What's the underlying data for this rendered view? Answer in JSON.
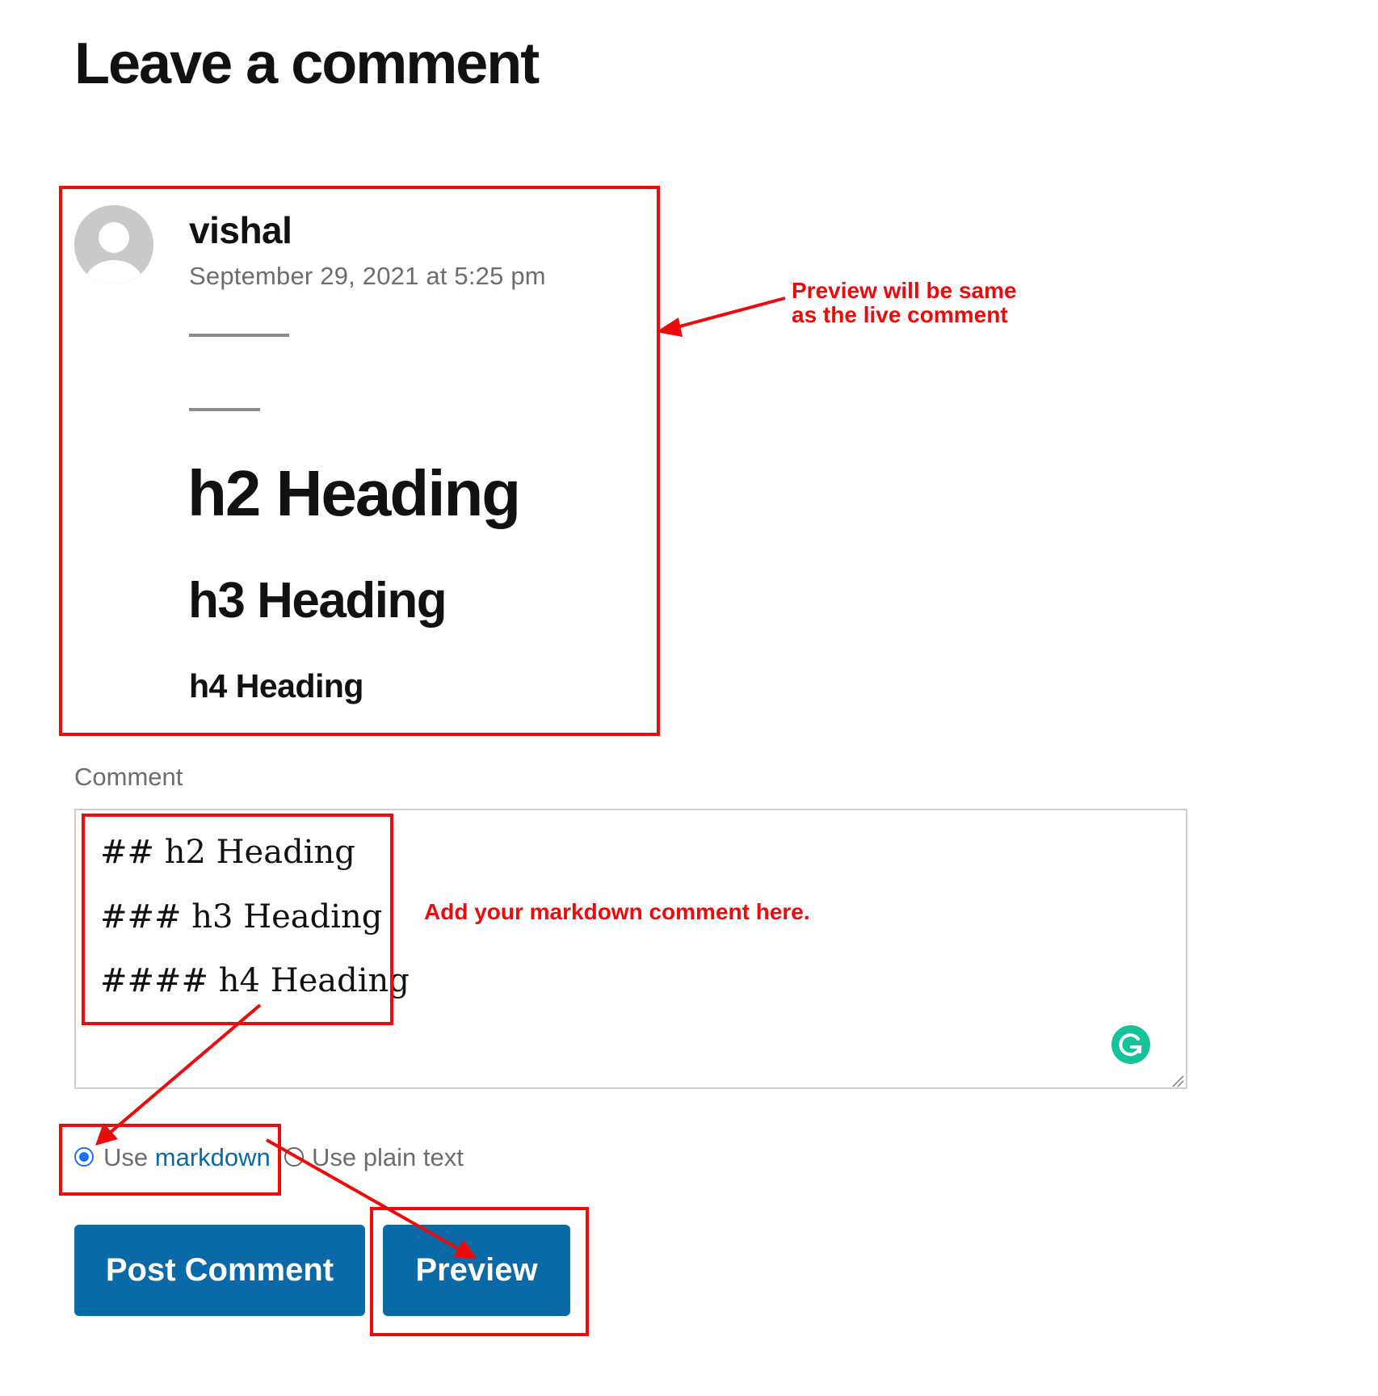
{
  "page": {
    "title": "Leave a comment"
  },
  "preview": {
    "author": "vishal",
    "date": "September 29, 2021 at 5:25 pm",
    "h2": "h2 Heading",
    "h3": "h3 Heading",
    "h4": "h4 Heading"
  },
  "form": {
    "comment_label": "Comment",
    "textarea_lines": [
      "## h2 Heading",
      "### h3 Heading",
      "#### h4 Heading"
    ],
    "format_options": {
      "markdown_prefix": "Use ",
      "markdown_link": "markdown",
      "plain": "Use plain text",
      "selected": "markdown"
    },
    "buttons": {
      "post": "Post Comment",
      "preview": "Preview"
    }
  },
  "annotations": {
    "preview_note_line1": "Preview will be same",
    "preview_note_line2": "as the live comment",
    "markdown_note": "Add your markdown comment here."
  },
  "colors": {
    "annotation_red": "#ee0a0a",
    "button_blue": "#0a6aa7",
    "radio_blue": "#1a73e8",
    "grammarly_green": "#15c39a"
  },
  "icons": {
    "avatar": "default-avatar-icon",
    "grammarly": "grammarly-icon",
    "resize": "resize-handle-icon"
  }
}
